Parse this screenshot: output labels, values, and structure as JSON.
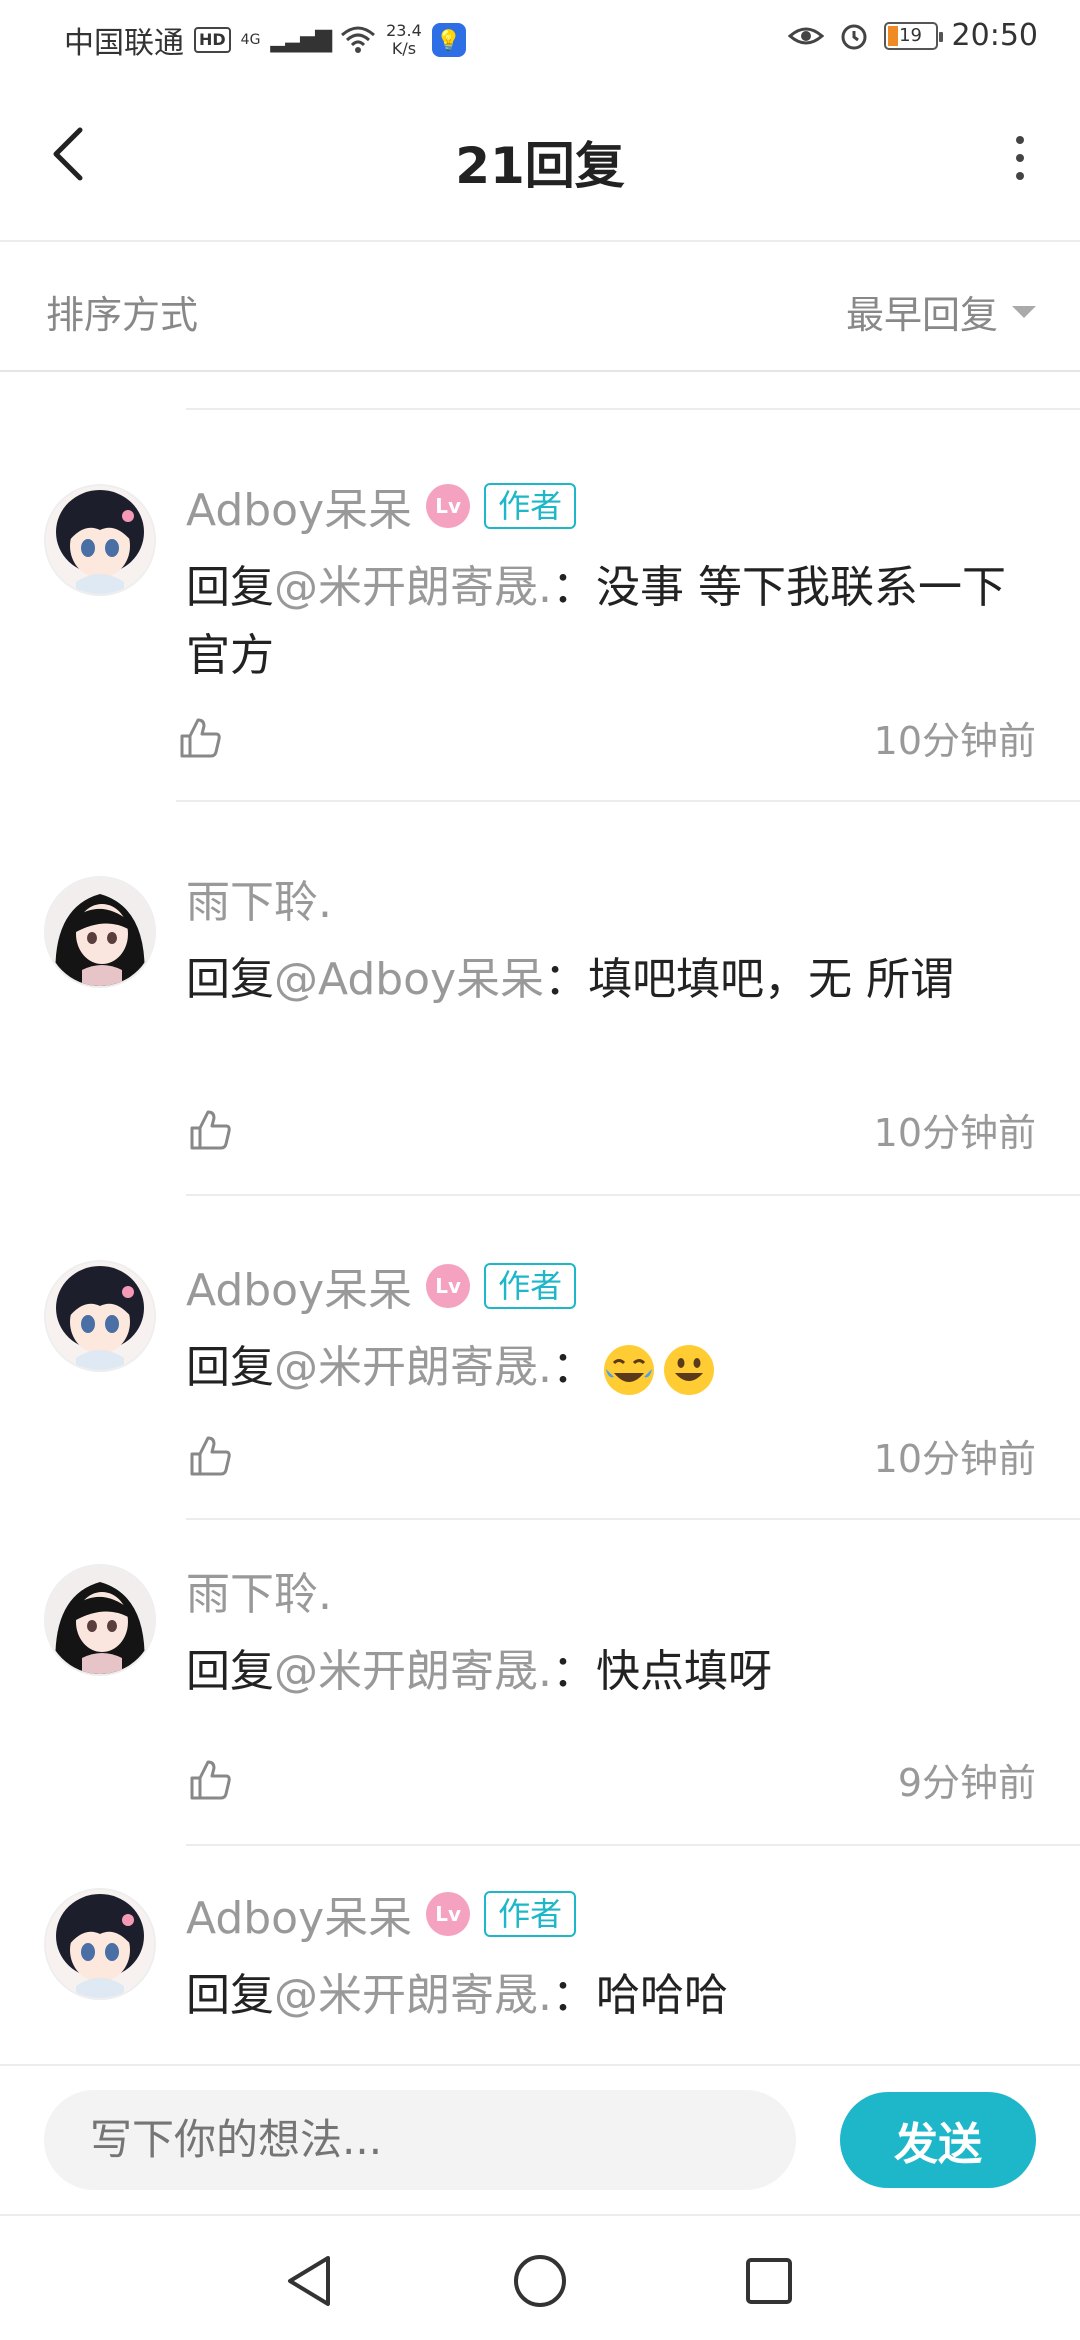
{
  "status_bar": {
    "carrier": "中国联通",
    "hd": "HD",
    "network_type": "4G",
    "net_speed_value": "23.4",
    "net_speed_unit": "K/s",
    "battery_level": "19",
    "time": "20:50"
  },
  "header": {
    "title": "21回复"
  },
  "sort": {
    "label": "排序方式",
    "selected": "最早回复"
  },
  "comments": [
    {
      "user": "Adboy呆呆",
      "level_badge": "Lv",
      "author_badge": "作者",
      "reply_prefix": "回复",
      "mention": "@米开朗寄晟.",
      "colon": "：",
      "text": "没事 等下我联系一下官方",
      "time": "10分钟前",
      "avatar": "avatar-a"
    },
    {
      "user": "雨下聆.",
      "reply_prefix": "回复",
      "mention": "@Adboy呆呆",
      "colon": "：",
      "text": "填吧填吧，无  所谓",
      "time": "10分钟前",
      "avatar": "avatar-b"
    },
    {
      "user": "Adboy呆呆",
      "level_badge": "Lv",
      "author_badge": "作者",
      "reply_prefix": "回复",
      "mention": "@米开朗寄晟.",
      "colon": "：",
      "text": "",
      "emojis": [
        "laughing-crying-emoji",
        "smiling-emoji"
      ],
      "time": "10分钟前",
      "avatar": "avatar-a"
    },
    {
      "user": "雨下聆.",
      "reply_prefix": "回复",
      "mention": "@米开朗寄晟.",
      "colon": "：",
      "text": "快点填呀",
      "time": "9分钟前",
      "avatar": "avatar-b"
    },
    {
      "user": "Adboy呆呆",
      "level_badge": "Lv",
      "author_badge": "作者",
      "reply_prefix": "回复",
      "mention": "@米开朗寄晟.",
      "colon": "：",
      "text": "哈哈哈",
      "avatar": "avatar-a"
    }
  ],
  "input": {
    "placeholder": "写下你的想法..."
  },
  "send_label": "发送",
  "colors": {
    "accent": "#1eb7c9",
    "muted_text": "#999999",
    "level_badge": "#f4a2c0"
  }
}
